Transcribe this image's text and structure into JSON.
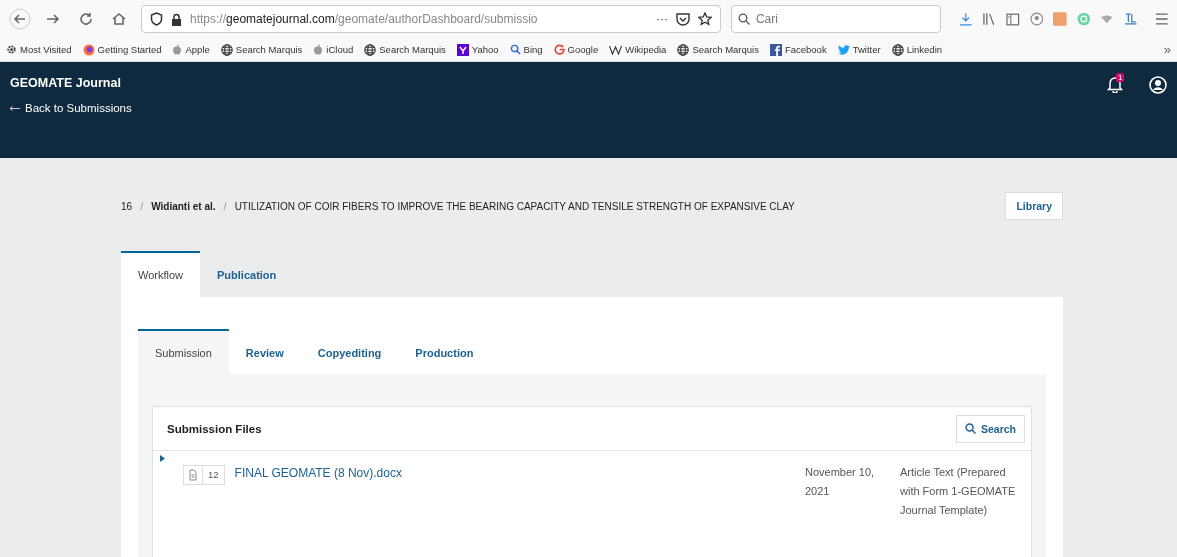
{
  "browser": {
    "url": "https://**geomatejournal.com**/geomate/authorDashboard/submissio",
    "url_menu": "···",
    "search": {
      "placeholder": "Cari"
    },
    "bookmarks": [
      {
        "kind": "gear",
        "label": "Most Visited"
      },
      {
        "kind": "firefox",
        "label": "Getting Started"
      },
      {
        "kind": "apple",
        "label": "Apple"
      },
      {
        "kind": "globe",
        "label": "Search Marquis"
      },
      {
        "kind": "apple",
        "label": "iCloud"
      },
      {
        "kind": "globe",
        "label": "Search Marquis"
      },
      {
        "kind": "yahoo",
        "label": "Yahoo"
      },
      {
        "kind": "search",
        "label": "Bing"
      },
      {
        "kind": "google",
        "label": "Google"
      },
      {
        "kind": "wiki",
        "label": "Wikipedia"
      },
      {
        "kind": "globe",
        "label": "Search Marquis"
      },
      {
        "kind": "facebook",
        "label": "Facebook"
      },
      {
        "kind": "twitter",
        "label": "Twitter"
      },
      {
        "kind": "globe",
        "label": "Linkedin"
      }
    ],
    "overflow": "»"
  },
  "header": {
    "title": "GEOMATE Journal",
    "back_link": "Back to Submissions",
    "notification_count": "1"
  },
  "breadcrumb": {
    "id": "16",
    "separator": "/",
    "authors": "Widianti et al.",
    "title": "UTILIZATION OF COIR FIBERS TO IMPROVE THE BEARING CAPACITY AND TENSILE STRENGTH OF EXPANSIVE CLAY",
    "library_button": "Library"
  },
  "tabs": [
    {
      "label": "Workflow",
      "selected": true
    },
    {
      "label": "Publication",
      "selected": false
    }
  ],
  "stage_tabs": [
    {
      "label": "Submission",
      "selected": true
    },
    {
      "label": "Review",
      "selected": false
    },
    {
      "label": "Copyediting",
      "selected": false
    },
    {
      "label": "Production",
      "selected": false
    }
  ],
  "files_panel": {
    "title": "Submission Files",
    "search_button": "Search",
    "rows": [
      {
        "expanded": false,
        "id": "12",
        "name": "FINAL GEOMATE (8 Nov).docx",
        "date": "November 10, 2021",
        "type": "Article Text (Prepared with Form 1-GEOMATE Journal Template)"
      }
    ]
  }
}
